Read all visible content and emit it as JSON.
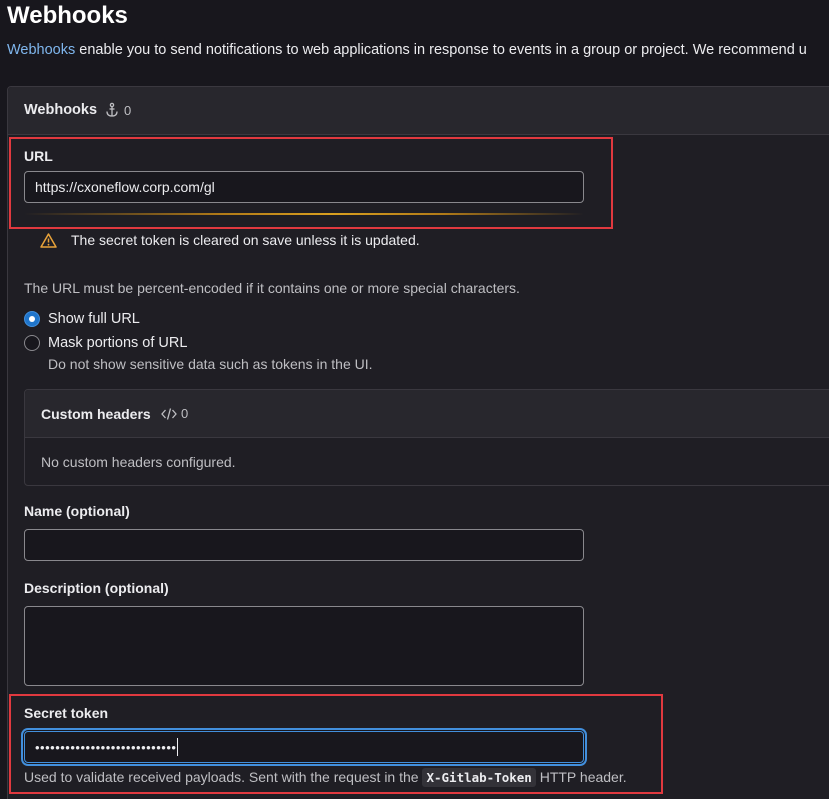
{
  "page": {
    "title": "Webhooks",
    "intro_link": "Webhooks",
    "intro_text": " enable you to send notifications to web applications in response to events in a group or project. We recommend u"
  },
  "card": {
    "title": "Webhooks",
    "count": "0",
    "count_icon": "anchor-icon"
  },
  "url_field": {
    "label": "URL",
    "value": "https://cxoneflow.corp.com/gl"
  },
  "warning": {
    "icon": "warning-icon",
    "text": "The secret token is cleared on save unless it is updated."
  },
  "url_help": "The URL must be percent-encoded if it contains one or more special characters.",
  "url_display": {
    "option_show": "Show full URL",
    "option_mask": "Mask portions of URL",
    "option_mask_help": "Do not show sensitive data such as tokens in the UI.",
    "selected": "Show full URL"
  },
  "custom_headers": {
    "title": "Custom headers",
    "count": "0",
    "count_icon": "code-icon",
    "empty_text": "No custom headers configured."
  },
  "name_field": {
    "label": "Name (optional)",
    "value": ""
  },
  "description_field": {
    "label": "Description (optional)",
    "value": ""
  },
  "secret_token": {
    "label": "Secret token",
    "value": "••••••••••••••••••••••••••••",
    "help_prefix": "Used to validate received payloads. Sent with the request in the ",
    "help_code": "X-Gitlab-Token",
    "help_suffix": " HTTP header."
  },
  "colors": {
    "accent_blue": "#428fdc",
    "link_blue": "#7fb6ed",
    "highlight_red": "#e0393f",
    "warning_orange": "#e9a33a"
  }
}
